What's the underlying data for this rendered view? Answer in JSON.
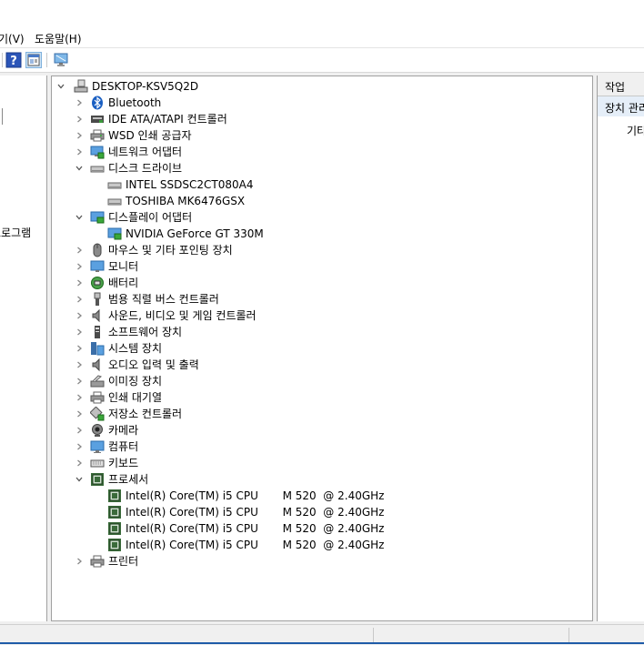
{
  "menubar": {
    "view_label": "기(V)",
    "help_label": "도움말(H)"
  },
  "left_pane": {
    "items": [
      "프로그램"
    ]
  },
  "tree": {
    "root": "DESKTOP-KSV5Q2D",
    "bluetooth": "Bluetooth",
    "ide": "IDE ATA/ATAPI 컨트롤러",
    "wsd": "WSD 인쇄 공급자",
    "network": "네트워크 어댑터",
    "disk": "디스크 드라이브",
    "disk_1": "INTEL SSDSC2CT080A4",
    "disk_2": "TOSHIBA MK6476GSX",
    "display": "디스플레이 어댑터",
    "display_1": "NVIDIA GeForce GT 330M",
    "mouse": "마우스 및 기타 포인팅 장치",
    "monitor": "모니터",
    "battery": "배터리",
    "usb": "범용 직렬 버스 컨트롤러",
    "sound": "사운드, 비디오 및 게임 컨트롤러",
    "software": "소프트웨어 장치",
    "system": "시스템 장치",
    "audio": "오디오 입력 및 출력",
    "imaging": "이미징 장치",
    "print_queue": "인쇄 대기열",
    "storage": "저장소 컨트롤러",
    "camera": "카메라",
    "computer": "컴퓨터",
    "keyboard": "키보드",
    "processor": "프로세서",
    "cpu_1": "Intel(R) Core(TM) i5 CPU       M 520  @ 2.40GHz",
    "cpu_2": "Intel(R) Core(TM) i5 CPU       M 520  @ 2.40GHz",
    "cpu_3": "Intel(R) Core(TM) i5 CPU       M 520  @ 2.40GHz",
    "cpu_4": "Intel(R) Core(TM) i5 CPU       M 520  @ 2.40GHz",
    "printer": "프린터"
  },
  "actions": {
    "header": "작업",
    "section": "장치 관리자",
    "more": "기타 작업"
  },
  "icons": {
    "help": "help-icon",
    "properties": "properties-icon",
    "scan": "scan-hardware-icon"
  },
  "colors": {
    "accent": "#1e5ba8",
    "selection": "#e5eef8"
  }
}
